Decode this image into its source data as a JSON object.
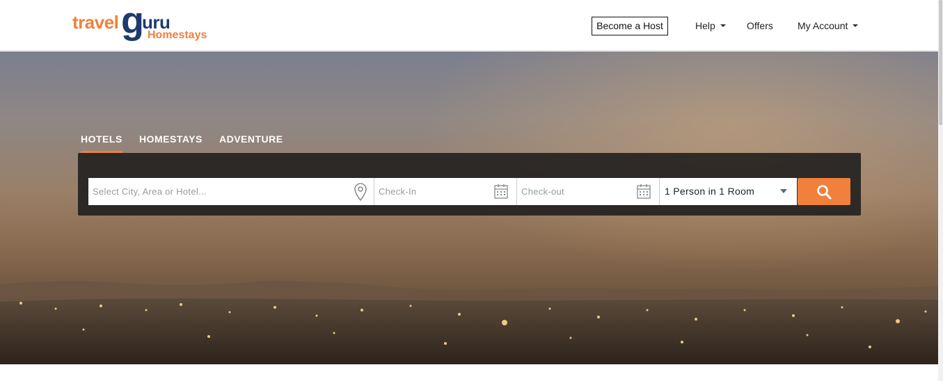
{
  "brand": {
    "part1": "travel",
    "part2_g": "g",
    "part2_rest": "uru",
    "subtitle": "Homestays",
    "colors": {
      "orange": "#f0803c",
      "navy": "#1d3b6e"
    }
  },
  "nav": {
    "become_host": "Become a Host",
    "help": "Help",
    "offers": "Offers",
    "my_account": "My Account"
  },
  "tabs": [
    {
      "label": "HOTELS",
      "active": true
    },
    {
      "label": "HOMESTAYS",
      "active": false
    },
    {
      "label": "ADVENTURE",
      "active": false
    }
  ],
  "search": {
    "destination_placeholder": "Select City, Area or Hotel...",
    "checkin_placeholder": "Check-In",
    "checkout_placeholder": "Check-out",
    "guests_value": "1 Person in 1 Room",
    "icons": [
      "map-pin-icon",
      "calendar-icon",
      "calendar-icon",
      "dropdown-caret-icon",
      "search-icon"
    ]
  },
  "accent": "#f0803c"
}
